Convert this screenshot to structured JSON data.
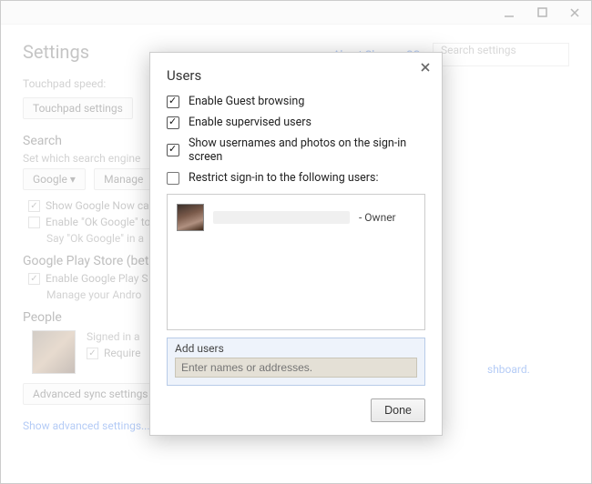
{
  "window": {
    "title": ""
  },
  "header": {
    "title": "Settings",
    "about_link": "About Chrome OS",
    "search_placeholder": "Search settings"
  },
  "background": {
    "touchpad_label": "Touchpad speed:",
    "touchpad_settings_btn": "Touchpad settings",
    "search_head": "Search",
    "search_desc": "Set which search engine",
    "google_btn": "Google",
    "manage_btn": "Manage",
    "show_google_now": "Show Google Now ca",
    "enable_ok_google": "Enable \"Ok Google\" to",
    "ok_google_hint": "Say \"Ok Google\" in a",
    "play_store_head": "Google Play Store (beta)",
    "enable_play": "Enable Google Play S",
    "manage_android": "Manage your Andro",
    "people_head": "People",
    "signed_in": "Signed in a",
    "require": "Require",
    "adv_sync_btn": "Advanced sync settings",
    "show_advanced": "Show advanced settings...",
    "dashboard_frag": "shboard."
  },
  "modal": {
    "title": "Users",
    "options": {
      "guest": {
        "label": "Enable Guest browsing",
        "checked": true
      },
      "supervised": {
        "label": "Enable supervised users",
        "checked": true
      },
      "show_usernames": {
        "label": "Show usernames and photos on the sign-in screen",
        "checked": true
      },
      "restrict": {
        "label": "Restrict sign-in to the following users:",
        "checked": false
      }
    },
    "user_owner_suffix": "- Owner",
    "add_users_label": "Add users",
    "add_users_placeholder": "Enter names or addresses.",
    "done_btn": "Done"
  }
}
